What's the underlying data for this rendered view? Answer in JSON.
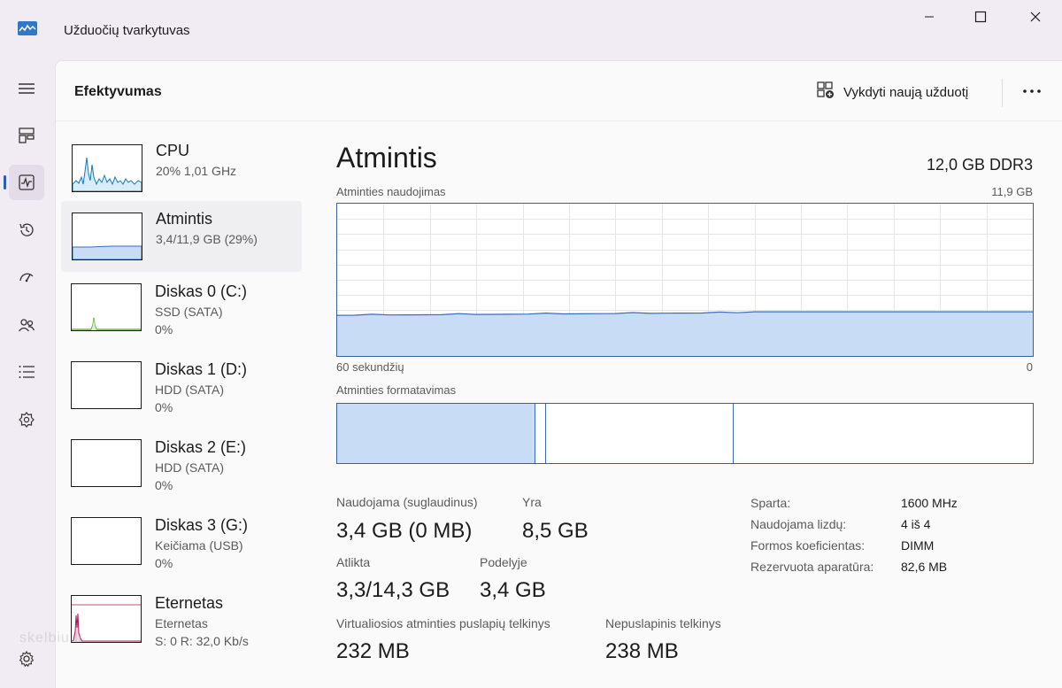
{
  "window": {
    "title": "Užduočių tvarkytuvas"
  },
  "header": {
    "title": "Efektyvumas",
    "run_task_label": "Vykdyti naują užduotį"
  },
  "nav": {
    "items": [
      "menu-icon",
      "processes-icon",
      "performance-icon",
      "app-history-icon",
      "startup-icon",
      "users-icon",
      "details-icon",
      "services-icon",
      "settings-icon"
    ],
    "active": "performance-icon"
  },
  "devices": [
    {
      "name": "CPU",
      "sub1": "20% 1,01 GHz",
      "sub2": "",
      "color": "#117dbb"
    },
    {
      "name": "Atmintis",
      "sub1": "3,4/11,9 GB (29%)",
      "sub2": "",
      "color": "#3a6cc0"
    },
    {
      "name": "Diskas 0 (C:)",
      "sub1": "SSD (SATA)",
      "sub2": "0%",
      "color": "#4da60c"
    },
    {
      "name": "Diskas 1 (D:)",
      "sub1": "HDD (SATA)",
      "sub2": "0%",
      "color": "#4da60c"
    },
    {
      "name": "Diskas 2 (E:)",
      "sub1": "HDD (SATA)",
      "sub2": "0%",
      "color": "#4da60c"
    },
    {
      "name": "Diskas 3 (G:)",
      "sub1": "Keičiama (USB)",
      "sub2": "0%",
      "color": "#4da60c"
    },
    {
      "name": "Eternetas",
      "sub1": "Eternetas",
      "sub2": "S: 0 R: 32,0 Kb/s",
      "color": "#a71a57"
    }
  ],
  "memory": {
    "title": "Atmintis",
    "type": "12,0 GB DDR3",
    "usage_label": "Atminties naudojimas",
    "usage_max": "11,9 GB",
    "time_left": "60 sekundžių",
    "time_right": "0",
    "composition_label": "Atminties formatavimas",
    "usage_fraction": 0.29,
    "composition": {
      "in_use": 0.285,
      "modified": 0.015,
      "standby": 0.27,
      "free": 0.43
    },
    "stats": {
      "in_use_label": "Naudojama (suglaudinus)",
      "in_use_value": "3,4 GB (0 MB)",
      "available_label": "Yra",
      "available_value": "8,5 GB",
      "committed_label": "Atlikta",
      "committed_value": "3,3/14,3 GB",
      "cached_label": "Podelyje",
      "cached_value": "3,4 GB",
      "paged_label": "Virtualiosios atminties puslapių telkinys",
      "paged_value": "232 MB",
      "nonpaged_label": "Nepuslapinis telkinys",
      "nonpaged_value": "238 MB"
    },
    "specs": [
      {
        "label": "Sparta:",
        "value": "1600 MHz"
      },
      {
        "label": "Naudojama lizdų:",
        "value": "4 iš 4"
      },
      {
        "label": "Formos koeficientas:",
        "value": "DIMM"
      },
      {
        "label": "Rezervuota aparatūra:",
        "value": "82,6 MB"
      }
    ]
  },
  "colors": {
    "memory_line": "#3a6cc0",
    "memory_fill": "#c9dcf6",
    "accent": "#2b5fb4"
  },
  "watermark": "skelbiu.lt"
}
